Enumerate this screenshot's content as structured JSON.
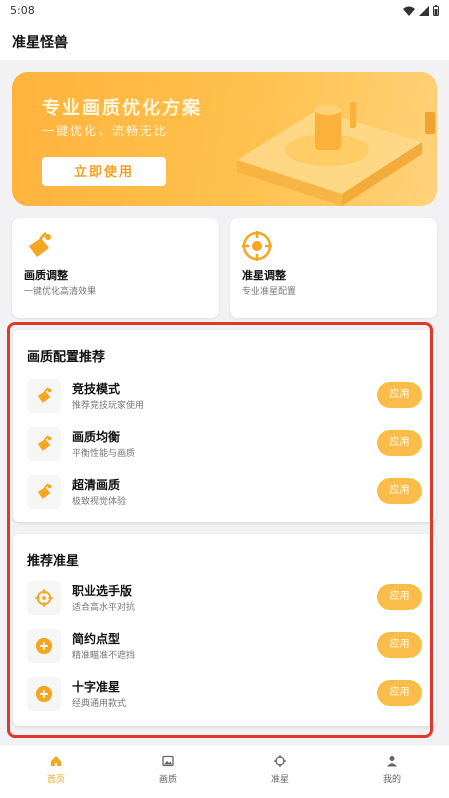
{
  "status_bar": {
    "time": "5:08",
    "icons": [
      "wifi-icon",
      "signal-icon",
      "battery-icon"
    ]
  },
  "app": {
    "title": "准星怪兽"
  },
  "banner": {
    "title": "专业画质优化方案",
    "subtitle": "一键优化，流畅无比",
    "button_label": "立即使用"
  },
  "features": [
    {
      "title": "画质调整",
      "desc": "一键优化高清效果",
      "icon": "paint-bucket-icon"
    },
    {
      "title": "准星调整",
      "desc": "专业准星配置",
      "icon": "crosshair-icon"
    }
  ],
  "graphics_section": {
    "title": "画质配置推荐",
    "items": [
      {
        "title": "竞技模式",
        "desc": "推荐竞技玩家使用",
        "button": "应用",
        "icon": "paint-bucket-icon"
      },
      {
        "title": "画质均衡",
        "desc": "平衡性能与画质",
        "button": "应用",
        "icon": "paint-bucket-icon"
      },
      {
        "title": "超清画质",
        "desc": "极致视觉体验",
        "button": "应用",
        "icon": "paint-bucket-icon"
      }
    ]
  },
  "crosshair_section": {
    "title": "推荐准星",
    "items": [
      {
        "title": "职业选手版",
        "desc": "适合高水平对抗",
        "button": "应用",
        "icon": "crosshair-icon"
      },
      {
        "title": "简约点型",
        "desc": "精准瞄准不遮挡",
        "button": "应用",
        "icon": "plus-circle-icon"
      },
      {
        "title": "十字准星",
        "desc": "经典通用款式",
        "button": "应用",
        "icon": "plus-circle-icon"
      }
    ]
  },
  "bottom_nav": [
    {
      "label": "首页",
      "icon": "home-icon",
      "active": true
    },
    {
      "label": "画质",
      "icon": "image-icon",
      "active": false
    },
    {
      "label": "准星",
      "icon": "crosshair-icon",
      "active": false
    },
    {
      "label": "我的",
      "icon": "person-icon",
      "active": false
    }
  ],
  "colors": {
    "accent": "#F5A623",
    "button": "#FBBD4A",
    "highlight_border": "#E2382C"
  }
}
